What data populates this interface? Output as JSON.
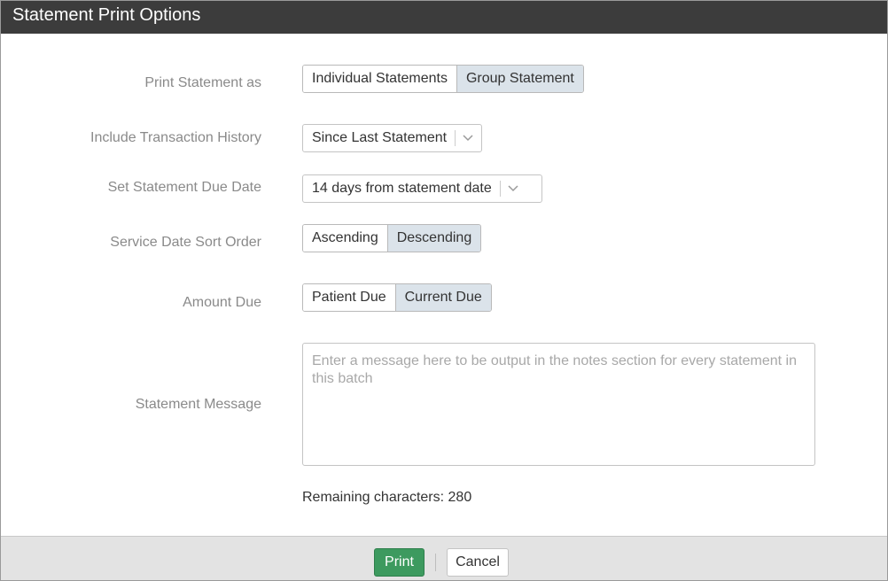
{
  "dialog": {
    "title": "Statement Print Options"
  },
  "form": {
    "print_as": {
      "label": "Print Statement as",
      "options": [
        "Individual Statements",
        "Group Statement"
      ],
      "selected": "Group Statement"
    },
    "history": {
      "label": "Include Transaction History",
      "value": "Since Last Statement"
    },
    "due_date": {
      "label": "Set Statement Due Date",
      "value": "14 days from statement date"
    },
    "sort_order": {
      "label": "Service Date Sort Order",
      "options": [
        "Ascending",
        "Descending"
      ],
      "selected": "Descending"
    },
    "amount_due": {
      "label": "Amount Due",
      "options": [
        "Patient Due",
        "Current Due"
      ],
      "selected": "Current Due"
    },
    "message": {
      "label": "Statement Message",
      "placeholder": "Enter a message here to be output in the notes section for every statement in this batch",
      "remaining": "Remaining characters: 280"
    }
  },
  "footer": {
    "print_label": "Print",
    "cancel_label": "Cancel"
  },
  "colors": {
    "titlebar": "#3c3c3c",
    "print_button": "#3d9a5f",
    "selected_segment": "#dbe3ea",
    "footer": "#e3e3e3"
  },
  "icons": {
    "dropdown": "chevron-down-icon"
  }
}
